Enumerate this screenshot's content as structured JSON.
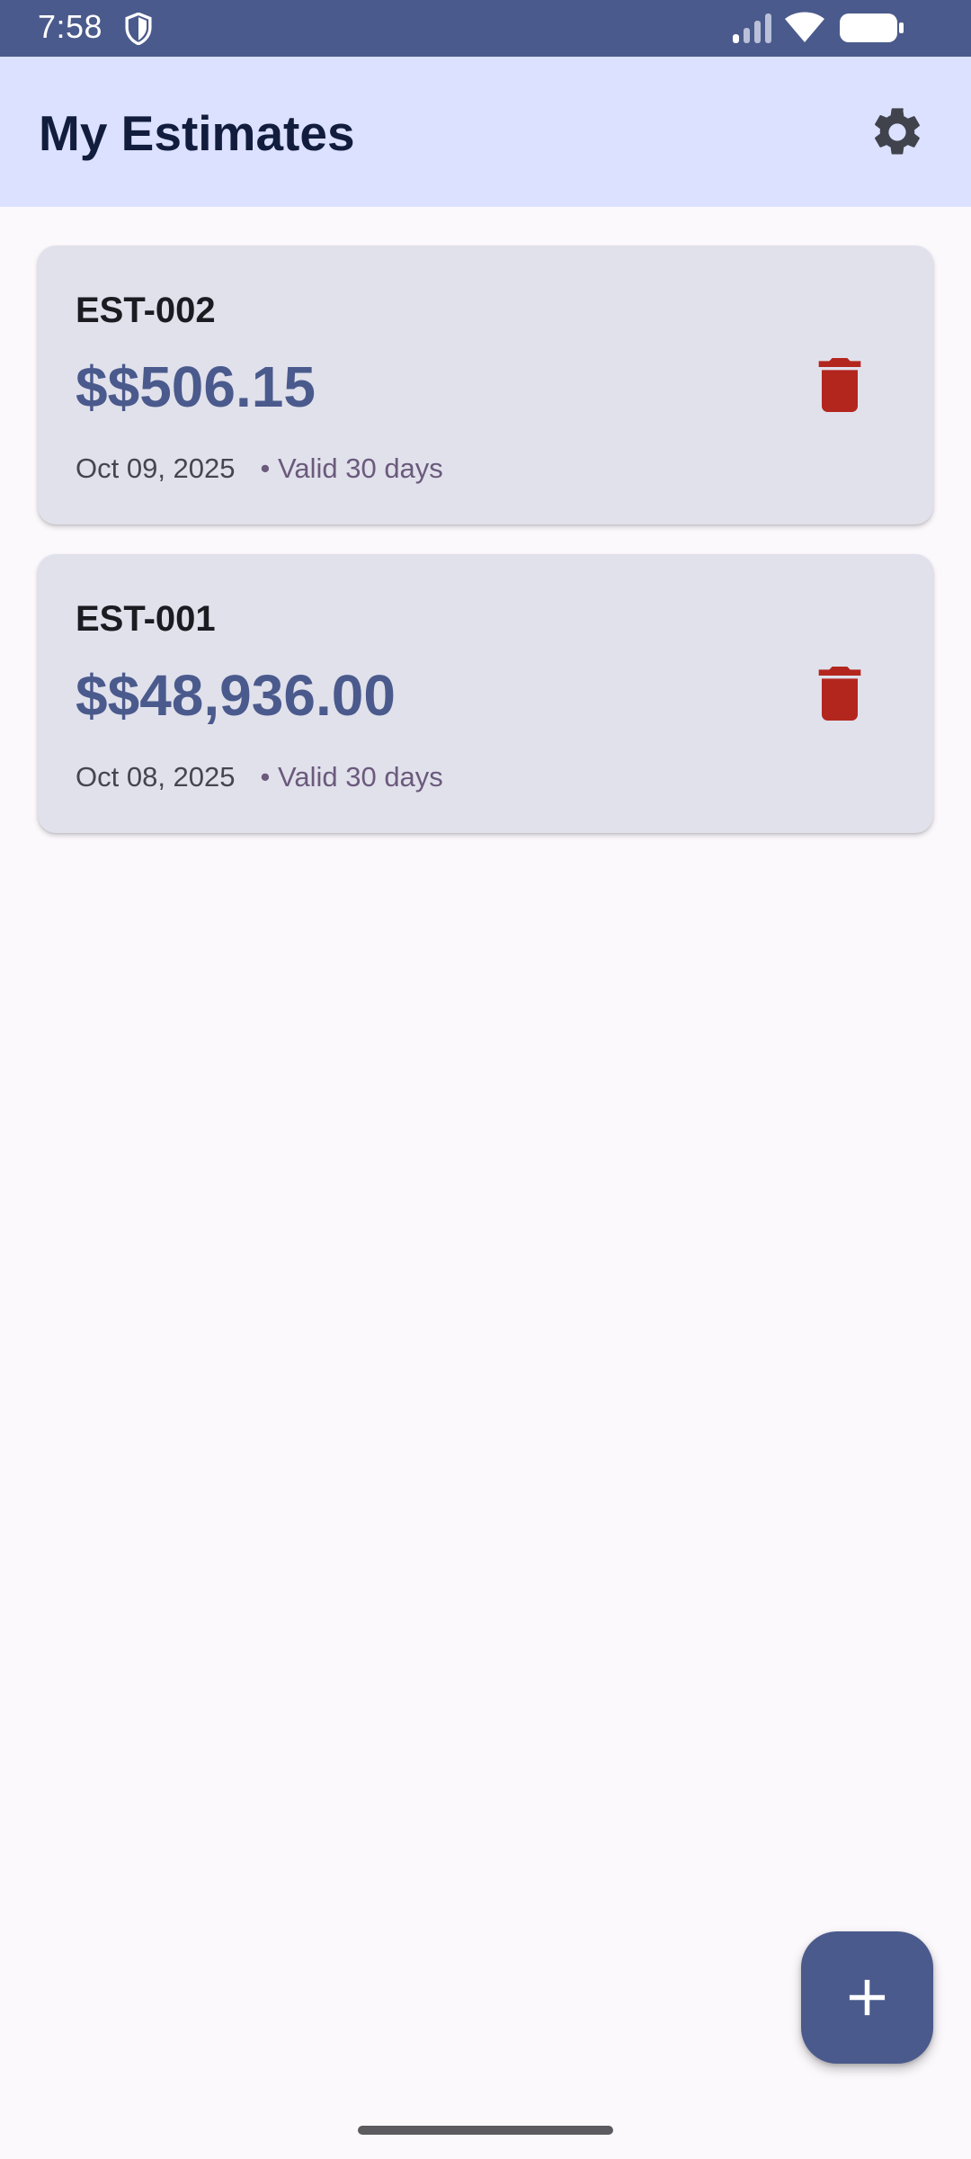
{
  "status_bar": {
    "time": "7:58",
    "icons": [
      "shield-icon",
      "signal-icon",
      "wifi-icon",
      "battery-icon"
    ]
  },
  "app_bar": {
    "title": "My Estimates",
    "settings_icon": "gear-icon"
  },
  "estimates": [
    {
      "id": "EST-002",
      "amount": "$$506.15",
      "date": "Oct 09, 2025",
      "validity": "• Valid 30 days",
      "delete_icon": "trash-icon"
    },
    {
      "id": "EST-001",
      "amount": "$$48,936.00",
      "date": "Oct 08, 2025",
      "validity": "• Valid 30 days",
      "delete_icon": "trash-icon"
    }
  ],
  "fab": {
    "icon": "plus-icon"
  },
  "colors": {
    "status_bar": "#4a5a8c",
    "app_bar": "#dbe1ff",
    "background": "#fcf9fd",
    "card": "#e1e1ec",
    "accent": "#4a5a8c",
    "delete": "#b3261e"
  }
}
